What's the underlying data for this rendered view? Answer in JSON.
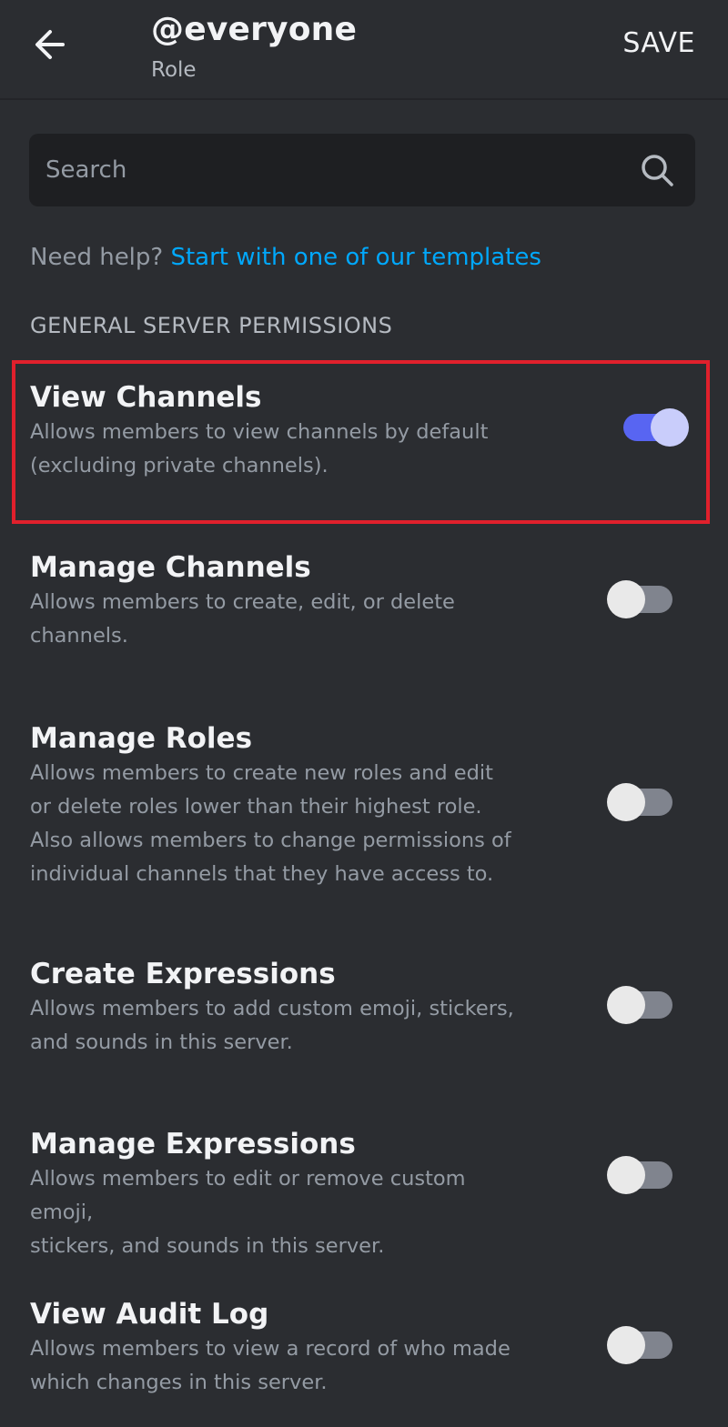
{
  "header": {
    "title": "@everyone",
    "subtitle": "Role",
    "save_label": "SAVE"
  },
  "search": {
    "placeholder": "Search"
  },
  "help": {
    "prefix": "Need help?",
    "link": "Start with one of our templates"
  },
  "section": {
    "title": "GENERAL SERVER PERMISSIONS"
  },
  "permissions": [
    {
      "title": "View Channels",
      "desc_lines": [
        "Allows members to view channels by default",
        "(excluding private channels)."
      ],
      "enabled": true
    },
    {
      "title": "Manage Channels",
      "desc_lines": [
        "Allows members to create, edit, or delete",
        "channels."
      ],
      "enabled": false
    },
    {
      "title": "Manage Roles",
      "desc_lines": [
        "Allows members to create new roles and edit",
        "or delete roles lower than their highest role.",
        "Also allows members to change permissions of",
        "individual channels that they have access to."
      ],
      "enabled": false
    },
    {
      "title": "Create Expressions",
      "desc_lines": [
        "Allows members to add custom emoji, stickers,",
        "and sounds in this server."
      ],
      "enabled": false
    },
    {
      "title": "Manage Expressions",
      "desc_lines": [
        "Allows members to edit or remove custom emoji,",
        "stickers, and sounds in this server."
      ],
      "enabled": false
    },
    {
      "title": "View Audit Log",
      "desc_lines": [
        "Allows members to view a record of who made",
        "which changes in this server."
      ],
      "enabled": false
    }
  ],
  "colors": {
    "background": "#2b2d31",
    "accent": "#5865f2",
    "link": "#00a8fc",
    "highlight": "#e0202c"
  }
}
